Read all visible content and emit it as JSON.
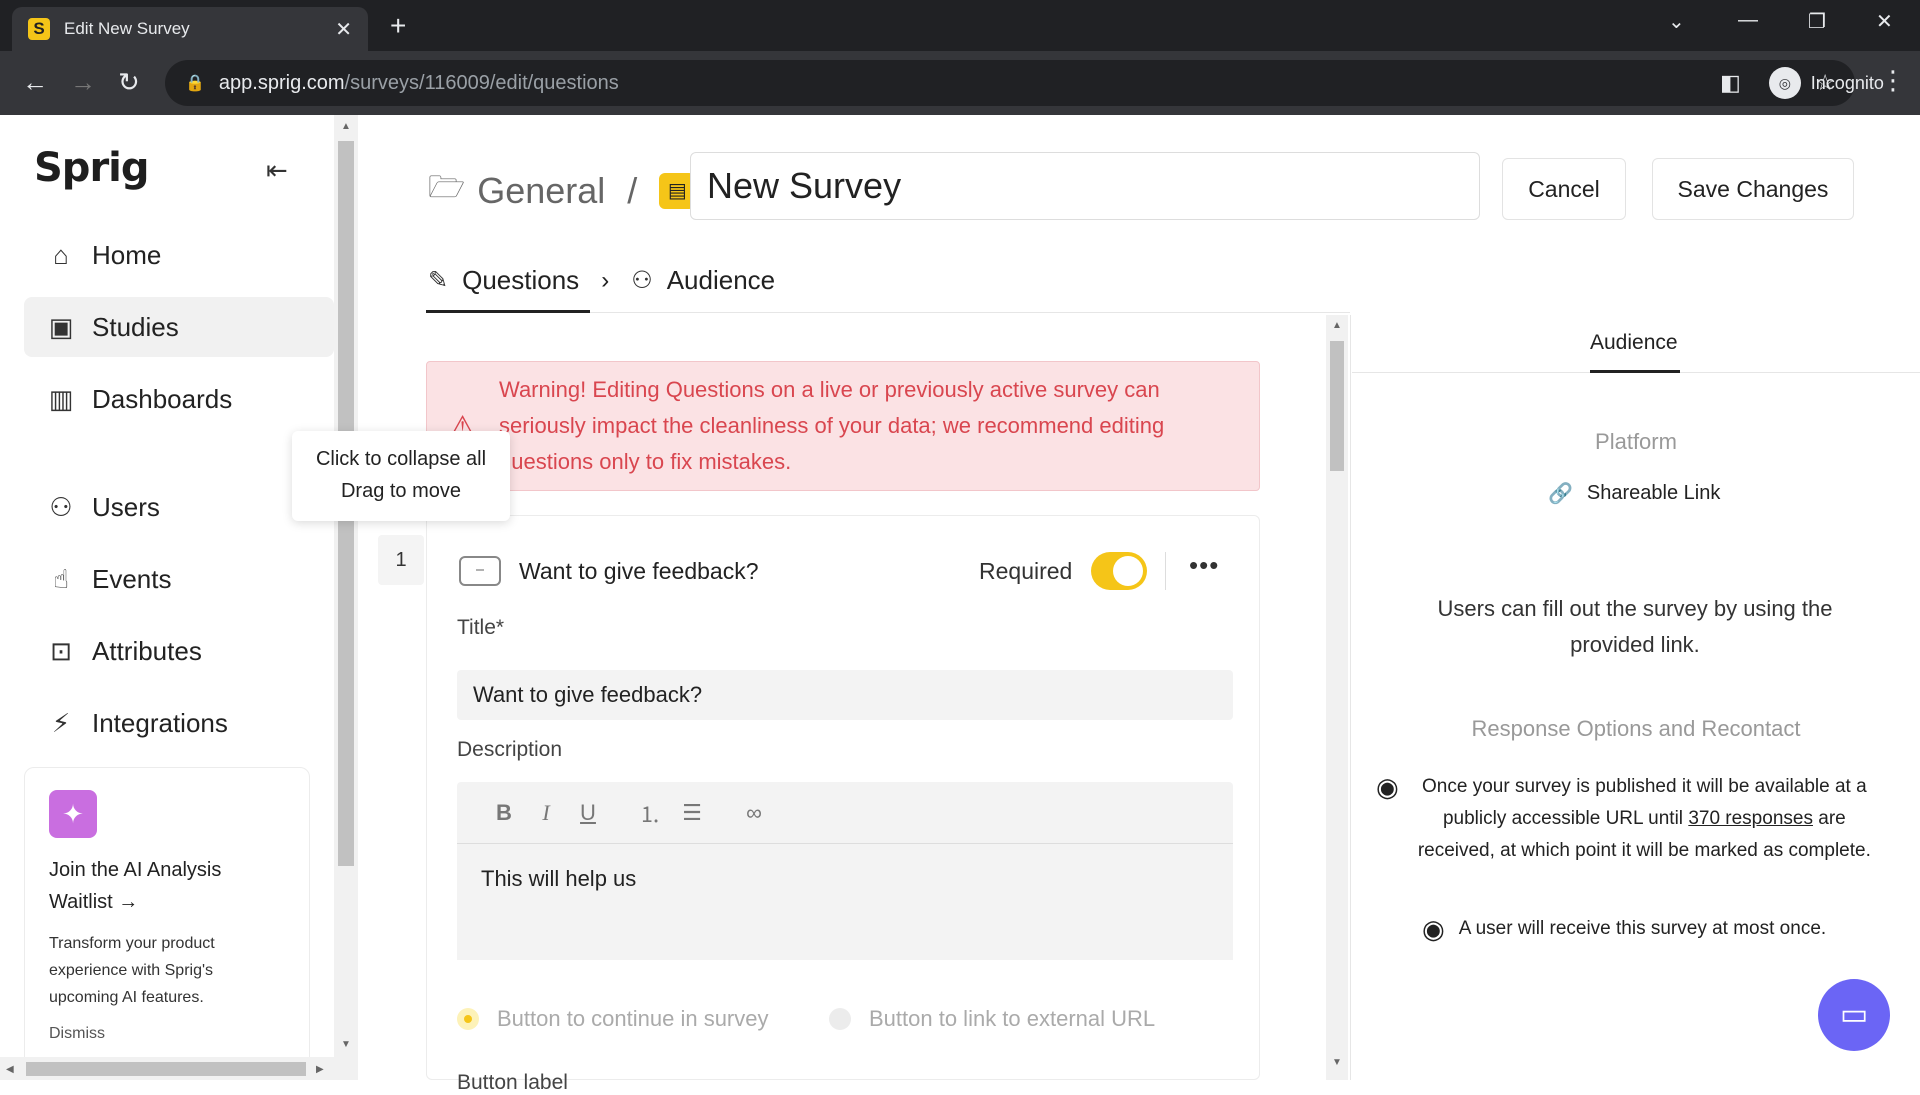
{
  "browser": {
    "tab_title": "Edit New Survey",
    "favicon_letter": "S",
    "url_host": "app.sprig.com",
    "url_path": "/surveys/116009/edit/questions",
    "profile_label": "Incognito"
  },
  "sidebar": {
    "logo": "Sprig",
    "items": [
      {
        "label": "Home",
        "icon": "home-icon"
      },
      {
        "label": "Studies",
        "icon": "studies-icon"
      },
      {
        "label": "Dashboards",
        "icon": "dashboard-icon"
      },
      {
        "label": "Users",
        "icon": "users-icon"
      },
      {
        "label": "Events",
        "icon": "events-icon"
      },
      {
        "label": "Attributes",
        "icon": "attributes-icon"
      },
      {
        "label": "Integrations",
        "icon": "integrations-icon"
      }
    ],
    "promo": {
      "title": "Join the AI Analysis Waitlist →",
      "body": "Transform your product experience with Sprig's upcoming AI features.",
      "dismiss": "Dismiss"
    }
  },
  "tooltip": {
    "line1": "Click to collapse all",
    "line2": "Drag to move"
  },
  "header": {
    "folder": "General",
    "separator": "/",
    "survey_title": "New Survey",
    "cancel_label": "Cancel",
    "save_label": "Save Changes"
  },
  "steps": {
    "questions": "Questions",
    "audience": "Audience"
  },
  "warning": {
    "text": "Warning! Editing Questions on a live or previously active survey can seriously impact the cleanliness of your data; we recommend editing questions only to fix mistakes."
  },
  "question": {
    "number": "1",
    "heading": "Want to give feedback?",
    "required_label": "Required",
    "required": true,
    "title_label": "Title*",
    "title_value": "Want to give feedback?",
    "description_label": "Description",
    "description_value": "This will help us",
    "option_continue": "Button to continue in survey",
    "option_external": "Button to link to external URL",
    "button_label": "Button label"
  },
  "panel": {
    "tab": "Audience",
    "platform_heading": "Platform",
    "platform_value": "Shareable Link",
    "platform_desc": "Users can fill out the survey by using the provided link.",
    "response_heading": "Response Options and Recontact",
    "response_info_pre": "Once your survey is published it will be available at a publicly accessible URL until ",
    "response_info_link": "370 responses",
    "response_info_post": " are received, at which point it will be marked as complete.",
    "recontact_info": "A user will receive this survey at most once."
  },
  "colors": {
    "accent": "#f5c518",
    "warning_bg": "#fbe2e4",
    "warning_text": "#d9464f",
    "chat": "#6b65f5"
  }
}
